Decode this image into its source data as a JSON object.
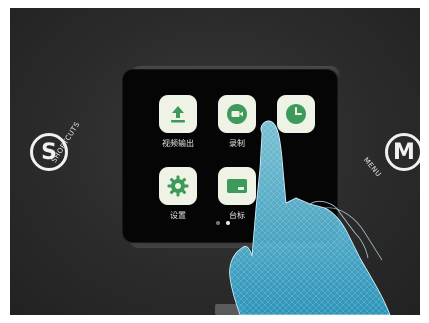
{
  "apps": [
    {
      "label": "视频输出",
      "icon": "upload-icon"
    },
    {
      "label": "录制",
      "icon": "record-icon"
    },
    {
      "label": "",
      "icon": "clock-icon"
    },
    {
      "label": "设置",
      "icon": "gear-icon"
    },
    {
      "label": "台标",
      "icon": "logo-overlay-icon"
    }
  ],
  "shortcuts": {
    "letter": "S",
    "label": "SHORTCUTS"
  },
  "menu": {
    "letter": "M",
    "label": "MENU"
  },
  "colors": {
    "icon_green": "#3e9a5a",
    "tile_bg": "#eef3e6",
    "hand": "#5ec8e8"
  },
  "pager": {
    "pages": 2,
    "active": 2
  }
}
